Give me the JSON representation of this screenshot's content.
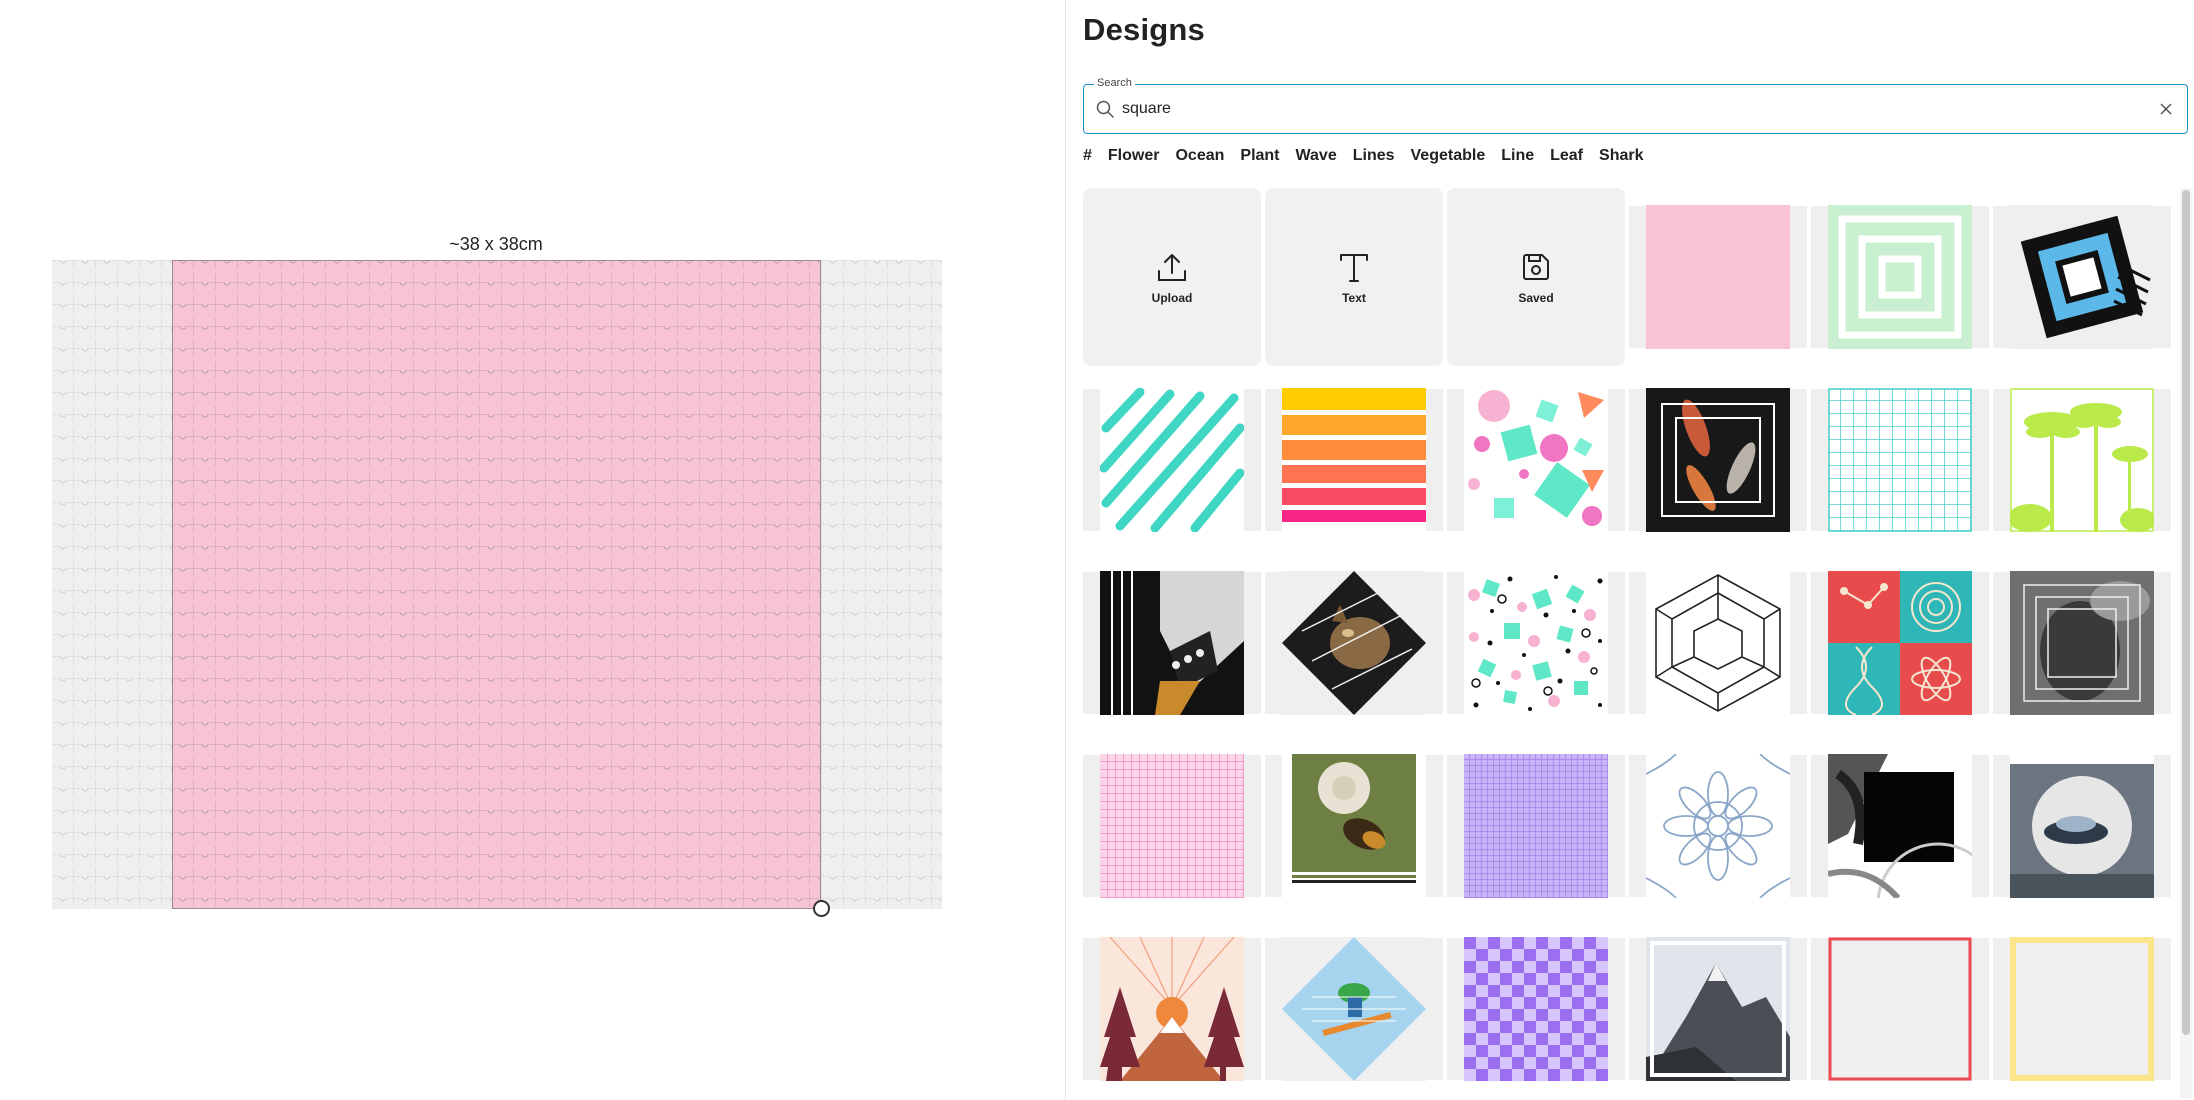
{
  "canvas": {
    "size_label": "~38 x 38cm",
    "design_color": "#f8c3d5",
    "board_color": "#efefef"
  },
  "panel": {
    "title": "Designs",
    "search": {
      "legend": "Search",
      "value": "square",
      "placeholder": "Search"
    },
    "tags": [
      "#",
      "Flower",
      "Ocean",
      "Plant",
      "Wave",
      "Lines",
      "Vegetable",
      "Line",
      "Leaf",
      "Shark"
    ],
    "actions": [
      {
        "label": "Upload",
        "icon": "upload-icon"
      },
      {
        "label": "Text",
        "icon": "text-icon"
      },
      {
        "label": "Saved",
        "icon": "save-icon"
      }
    ],
    "designs": [
      "pink-square",
      "green-concentric-squares",
      "blue-black-square",
      "teal-scribble-square",
      "sunset-stripes-square",
      "pink-teal-confetti-shapes",
      "koi-fish-photo-square",
      "teal-grid-square",
      "lime-palm-trees-square",
      "guitar-photo-square",
      "cat-diamond-square",
      "dots-confetti-square",
      "impossible-cube-line-art",
      "science-dna-atom-square",
      "bw-photo-nested-squares",
      "pink-gingham-square",
      "bee-flower-photo",
      "purple-gingham-square",
      "blue-mandala-square",
      "bw-cyclist-square",
      "car-circle-photo",
      "mountain-sunrise-illustration",
      "snowboarder-diamond",
      "purple-checkerboard",
      "mountain-photo-framed",
      "red-square-frame",
      "yellow-square-frame"
    ]
  }
}
